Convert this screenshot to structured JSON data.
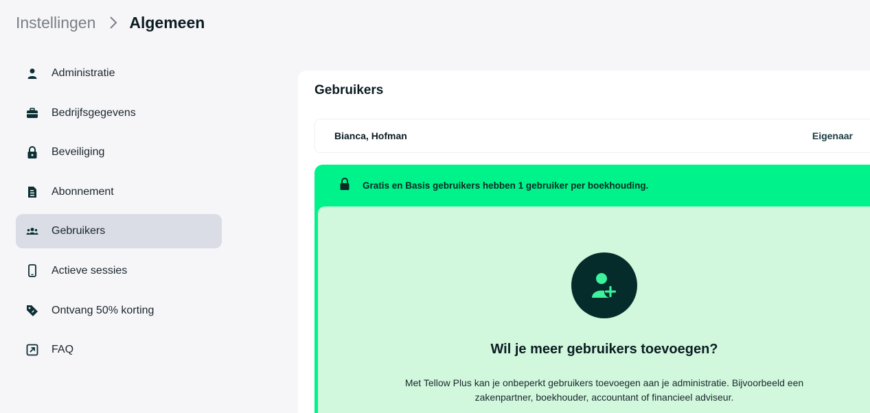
{
  "breadcrumb": {
    "parent": "Instellingen",
    "current": "Algemeen"
  },
  "sidebar": {
    "items": [
      {
        "label": "Administratie",
        "icon": "person-icon"
      },
      {
        "label": "Bedrijfsgegevens",
        "icon": "briefcase-icon"
      },
      {
        "label": "Beveiliging",
        "icon": "lock-icon"
      },
      {
        "label": "Abonnement",
        "icon": "document-icon"
      },
      {
        "label": "Gebruikers",
        "icon": "users-icon",
        "active": true
      },
      {
        "label": "Actieve sessies",
        "icon": "phone-icon"
      },
      {
        "label": "Ontvang 50% korting",
        "icon": "tag-icon"
      },
      {
        "label": "FAQ",
        "icon": "external-link-icon"
      }
    ]
  },
  "main": {
    "title": "Gebruikers",
    "users": [
      {
        "name": "Bianca, Hofman",
        "role": "Eigenaar"
      }
    ],
    "upsell": {
      "banner": "Gratis en Basis gebruikers hebben 1 gebruiker per boekhouding.",
      "heading": "Wil je meer gebruikers toevoegen?",
      "description": "Met Tellow Plus kan je onbeperkt gebruikers toevoegen aan je administratie. Bijvoorbeeld een zakenpartner, boekhouder, accountant of financieel adviseur."
    }
  },
  "colors": {
    "accent": "#00f28b",
    "accent_light": "#d1f8dd",
    "dark": "#052c2a",
    "active_bg": "#dadde5"
  }
}
